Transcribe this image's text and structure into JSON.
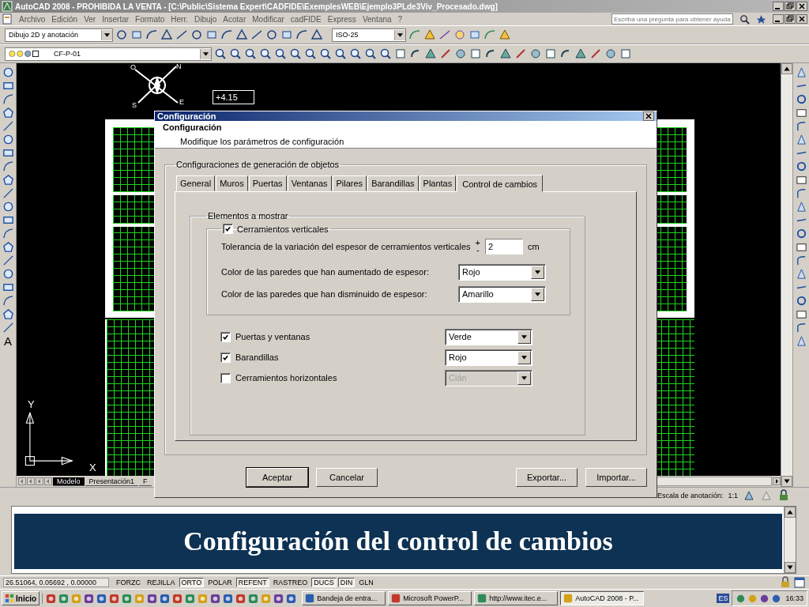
{
  "window": {
    "title": "AutoCAD 2008 - PROHIBIDA LA VENTA - [C:\\Public\\Sistema Expert\\CADFIDE\\ExemplesWEB\\Ejemplo3PLde3Viv_Procesado.dwg]"
  },
  "menu": [
    "Archivo",
    "Edición",
    "Ver",
    "Insertar",
    "Formato",
    "Herr.",
    "Dibujo",
    "Acotar",
    "Modificar",
    "cadFIDE",
    "Express",
    "Ventana",
    "?"
  ],
  "help_search": {
    "placeholder": "Escriba una pregunta para obtener ayuda"
  },
  "toolbars": {
    "workspace": "Dibujo 2D y anotación",
    "dim_style": "ISO-25",
    "layer": "CF-P-01"
  },
  "left_toolbar": {
    "text_tool": "A"
  },
  "canvas": {
    "elevation_label": "+4.15",
    "compass_letters": [
      "O",
      "N",
      "S",
      "E"
    ],
    "axis_y": "Y",
    "axis_x": "X"
  },
  "layout_tabs": [
    {
      "label": "Modelo",
      "selected": true
    },
    {
      "label": "Presentación1",
      "selected": false
    },
    {
      "label": "F",
      "selected": false
    }
  ],
  "annotation_scale": {
    "label": "Escala de anotación:",
    "value": "1:1"
  },
  "dialog": {
    "title": "Configuración",
    "heading": "Configuración",
    "subheading": "Modifique los parámetros de configuración",
    "group_title": "Configuraciones de generación de objetos",
    "tabs": [
      {
        "label": "General",
        "selected": false
      },
      {
        "label": "Muros",
        "selected": false
      },
      {
        "label": "Puertas",
        "selected": false
      },
      {
        "label": "Ventanas",
        "selected": false
      },
      {
        "label": "Pilares",
        "selected": false
      },
      {
        "label": "Barandillas",
        "selected": false
      },
      {
        "label": "Plantas",
        "selected": false
      },
      {
        "label": "Control de cambios",
        "selected": true
      }
    ],
    "elements_group": "Elementos a mostrar",
    "vertical_walls": {
      "label": "Cerramientos verticales",
      "checked": true,
      "tolerance_label": "Tolerancia de la variación del espesor de cerramientos verticales",
      "plus": "+",
      "minus": "-",
      "tolerance_value": "2",
      "unit": "cm",
      "color_rows": [
        {
          "label": "Color de las paredes que han aumentado de espesor:",
          "value": "Rojo"
        },
        {
          "label": "Color de las paredes que han disminuido de espesor:",
          "value": "Amarillo"
        }
      ]
    },
    "items": [
      {
        "label": "Puertas y ventanas",
        "checked": true,
        "value": "Verde",
        "disabled": false
      },
      {
        "label": "Barandillas",
        "checked": true,
        "value": "Rojo",
        "disabled": false
      },
      {
        "label": "Cerramientos horizontales",
        "checked": false,
        "value": "Cián",
        "disabled": true
      }
    ],
    "buttons": [
      {
        "label": "Aceptar",
        "default": true
      },
      {
        "label": "Cancelar",
        "default": false
      },
      {
        "label": "Exportar...",
        "default": false
      },
      {
        "label": "Importar...",
        "default": false
      }
    ]
  },
  "banner": "Configuración del control de cambios",
  "status_bar": {
    "coordinates": "26.51064, 0.05692 , 0.00000",
    "toggles": [
      {
        "label": "FORZC",
        "on": false
      },
      {
        "label": "REJILLA",
        "on": false
      },
      {
        "label": "ORTO",
        "on": true
      },
      {
        "label": "POLAR",
        "on": false
      },
      {
        "label": "REFENT",
        "on": true
      },
      {
        "label": "RASTREO",
        "on": false
      },
      {
        "label": "DUCS",
        "on": true
      },
      {
        "label": "DIN",
        "on": true
      },
      {
        "label": "GLN",
        "on": false
      }
    ]
  },
  "taskbar": {
    "start": "Inicio",
    "tasks": [
      {
        "label": "Bandeja de entra...",
        "selected": false
      },
      {
        "label": "Microsoft PowerP...",
        "selected": false
      },
      {
        "label": "http://www.itec.e...",
        "selected": false
      },
      {
        "label": "AutoCAD 2008 - P...",
        "selected": true
      }
    ],
    "language": "ES",
    "clock": "16:33"
  }
}
